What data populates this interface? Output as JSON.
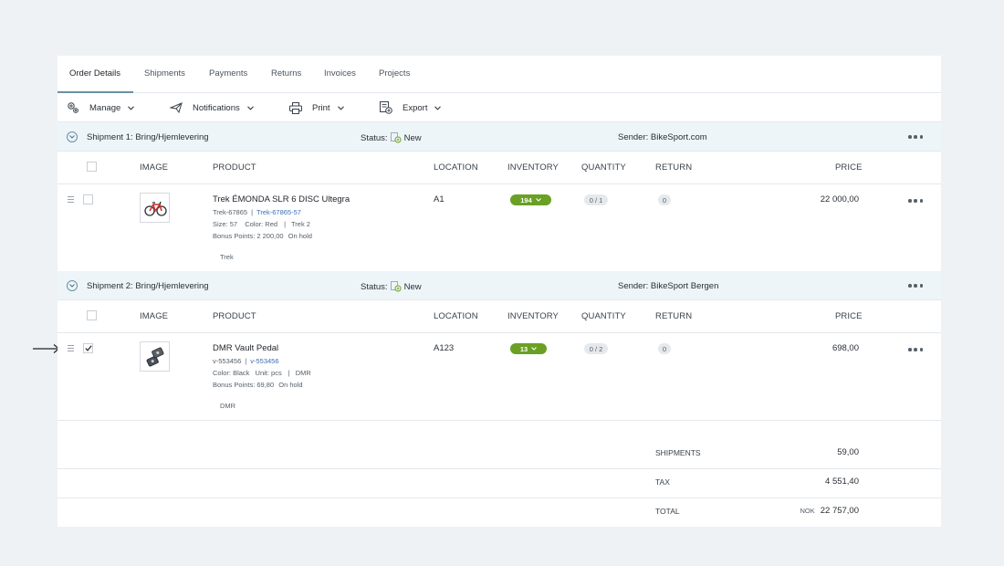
{
  "tabs": [
    "Order Details",
    "Shipments",
    "Payments",
    "Returns",
    "Invoices",
    "Projects"
  ],
  "toolbar": {
    "manage": "Manage",
    "notifications": "Notifications",
    "print": "Print",
    "export": "Export"
  },
  "columns": {
    "image": "IMAGE",
    "product": "PRODUCT",
    "location": "LOCATION",
    "inventory": "INVENTORY",
    "quantity": "QUANTITY",
    "return": "RETURN",
    "price": "PRICE"
  },
  "status_label": "Status:",
  "shipments": [
    {
      "title": "Shipment 1: Bring/Hjemlevering",
      "status": "New",
      "sender": "Sender: BikeSport.com",
      "item": {
        "checked": false,
        "icon": "bicycle-icon",
        "name": "Trek ÉMONDA SLR 6 DISC Ultegra",
        "sku": "Trek-67865",
        "sku_link": "Trek-67865-57",
        "attr1": "Size: 57",
        "attr2": "Color: Red",
        "attr3": "Trek 2",
        "bonus": "Bonus Points: 2 200,00",
        "hold": "On hold",
        "tag": "Trek",
        "location": "A1",
        "inventory": "194",
        "quantity": "0 / 1",
        "return": "0",
        "price": "22 000,00"
      }
    },
    {
      "title": "Shipment 2: Bring/Hjemlevering",
      "status": "New",
      "sender": "Sender: BikeSport Bergen",
      "item": {
        "checked": true,
        "icon": "pedal-icon",
        "name": "DMR Vault Pedal",
        "sku": "v-553456",
        "sku_link": "v-553456",
        "attr1": "Color: Black",
        "attr2": "Unit: pcs",
        "attr3": "DMR",
        "bonus": "Bonus Points: 69,80",
        "hold": "On hold",
        "tag": "DMR",
        "location": "A123",
        "inventory": "13",
        "quantity": "0 / 2",
        "return": "0",
        "price": "698,00"
      }
    }
  ],
  "totals": {
    "shipments_label": "SHIPMENTS",
    "shipments_value": "59,00",
    "tax_label": "TAX",
    "tax_value": "4 551,40",
    "total_label": "TOTAL",
    "currency": "NOK",
    "total_value": "22 757,00"
  },
  "colors": {
    "inventory_badge": "#6aa024",
    "shipment_header": "#edf5f8",
    "link": "#3b6fb6",
    "background": "#eef2f5"
  }
}
